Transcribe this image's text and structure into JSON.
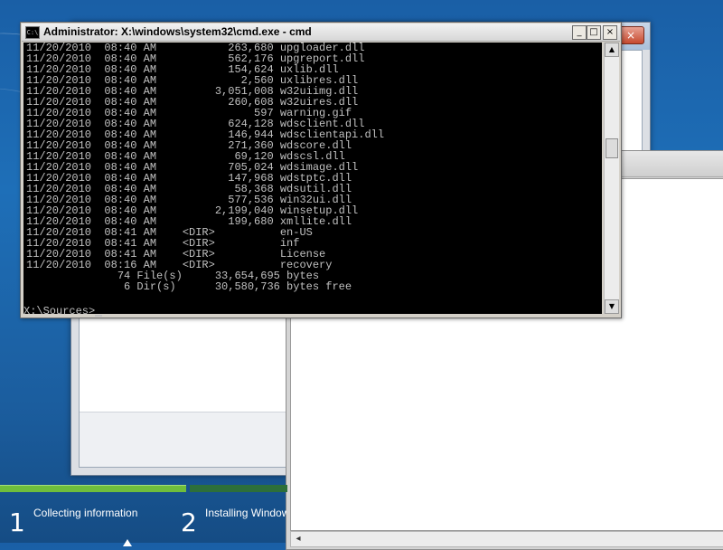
{
  "cmd": {
    "title": "Administrator: X:\\windows\\system32\\cmd.exe - cmd",
    "minimize_glyph": "_",
    "maximize_glyph": "□",
    "close_glyph": "×",
    "lines": [
      "11/20/2010  08:40 AM           263,680 upgloader.dll",
      "11/20/2010  08:40 AM           562,176 upgreport.dll",
      "11/20/2010  08:40 AM           154,624 uxlib.dll",
      "11/20/2010  08:40 AM             2,560 uxlibres.dll",
      "11/20/2010  08:40 AM         3,051,008 w32uiimg.dll",
      "11/20/2010  08:40 AM           260,608 w32uires.dll",
      "11/20/2010  08:40 AM               597 warning.gif",
      "11/20/2010  08:40 AM           624,128 wdsclient.dll",
      "11/20/2010  08:40 AM           146,944 wdsclientapi.dll",
      "11/20/2010  08:40 AM           271,360 wdscore.dll",
      "11/20/2010  08:40 AM            69,120 wdscsl.dll",
      "11/20/2010  08:40 AM           705,024 wdsimage.dll",
      "11/20/2010  08:40 AM           147,968 wdstptc.dll",
      "11/20/2010  08:40 AM            58,368 wdsutil.dll",
      "11/20/2010  08:40 AM           577,536 win32ui.dll",
      "11/20/2010  08:40 AM         2,199,040 winsetup.dll",
      "11/20/2010  08:40 AM           199,680 xmllite.dll",
      "11/20/2010  08:41 AM    <DIR>          en-US",
      "11/20/2010  08:41 AM    <DIR>          inf",
      "11/20/2010  08:41 AM    <DIR>          License",
      "11/20/2010  08:16 AM    <DIR>          recovery",
      "              74 File(s)     33,654,695 bytes",
      "               6 Dir(s)      30,580,736 bytes free"
    ],
    "prompt": "X:\\Sources>"
  },
  "setup_window": {
    "close_glyph": "×"
  },
  "progress": {
    "steps": [
      {
        "number": "1",
        "label": "Collecting information"
      },
      {
        "number": "2",
        "label": "Installing Windows"
      }
    ]
  },
  "colors": {
    "desktop": "#1e6fb8",
    "console_bg": "#000000",
    "console_text": "#c0c0c0",
    "progress_done": "#6fbe3c",
    "progress_pending": "#2d6f3a"
  }
}
